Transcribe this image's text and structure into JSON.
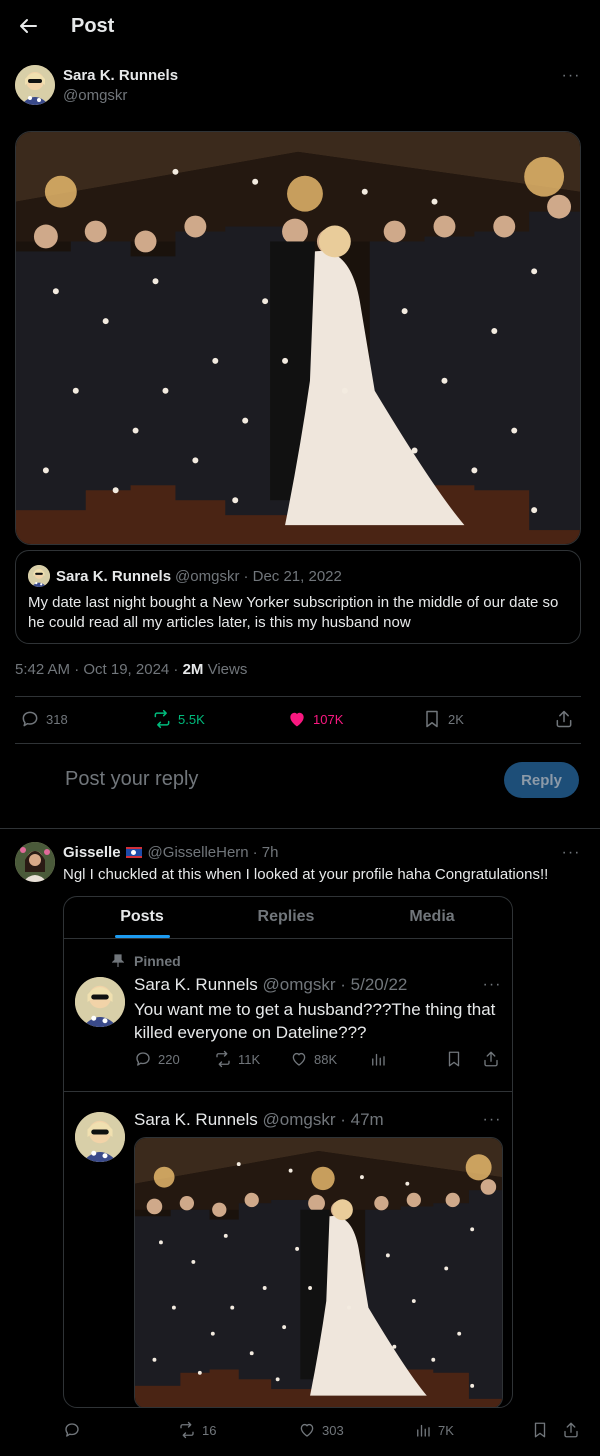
{
  "header": {
    "title": "Post"
  },
  "main_post": {
    "author_name": "Sara K. Runnels",
    "author_handle": "@omgskr",
    "quoted": {
      "author_name": "Sara K. Runnels",
      "author_handle": "@omgskr",
      "date": "· Dec 21, 2022",
      "text": "My date last night bought a New Yorker subscription in the middle of our date so he could read all my articles later, is this my husband now"
    },
    "timestamp": "5:42 AM · Oct 19, 2024 · ",
    "views_count": "2M",
    "views_label": " Views",
    "stats": {
      "replies": "318",
      "reposts": "5.5K",
      "likes": "107K",
      "bookmarks": "2K"
    },
    "colors": {
      "repost": "#00ba7c",
      "like": "#f91880"
    }
  },
  "reply_box": {
    "placeholder": "Post your reply",
    "button": "Reply"
  },
  "reply": {
    "author_name": "Gisselle",
    "author_handle": "@GisselleHern",
    "time": "· 7h",
    "text": "Ngl I chuckled at this when I looked at your profile haha Congratulations!!",
    "card": {
      "tabs": [
        "Posts",
        "Replies",
        "Media"
      ],
      "pinned_label": "Pinned",
      "post1": {
        "author_name": "Sara K. Runnels",
        "author_handle": "@omgskr",
        "date": "· 5/20/22",
        "text": "You want me to get a husband???The thing that killed everyone on Dateline???",
        "stats": {
          "replies": "220",
          "reposts": "11K",
          "likes": "88K"
        }
      },
      "post2": {
        "author_name": "Sara K. Runnels",
        "author_handle": "@omgskr",
        "date": "· 47m"
      }
    },
    "stats": {
      "reposts": "16",
      "likes": "303",
      "views": "7K"
    }
  }
}
